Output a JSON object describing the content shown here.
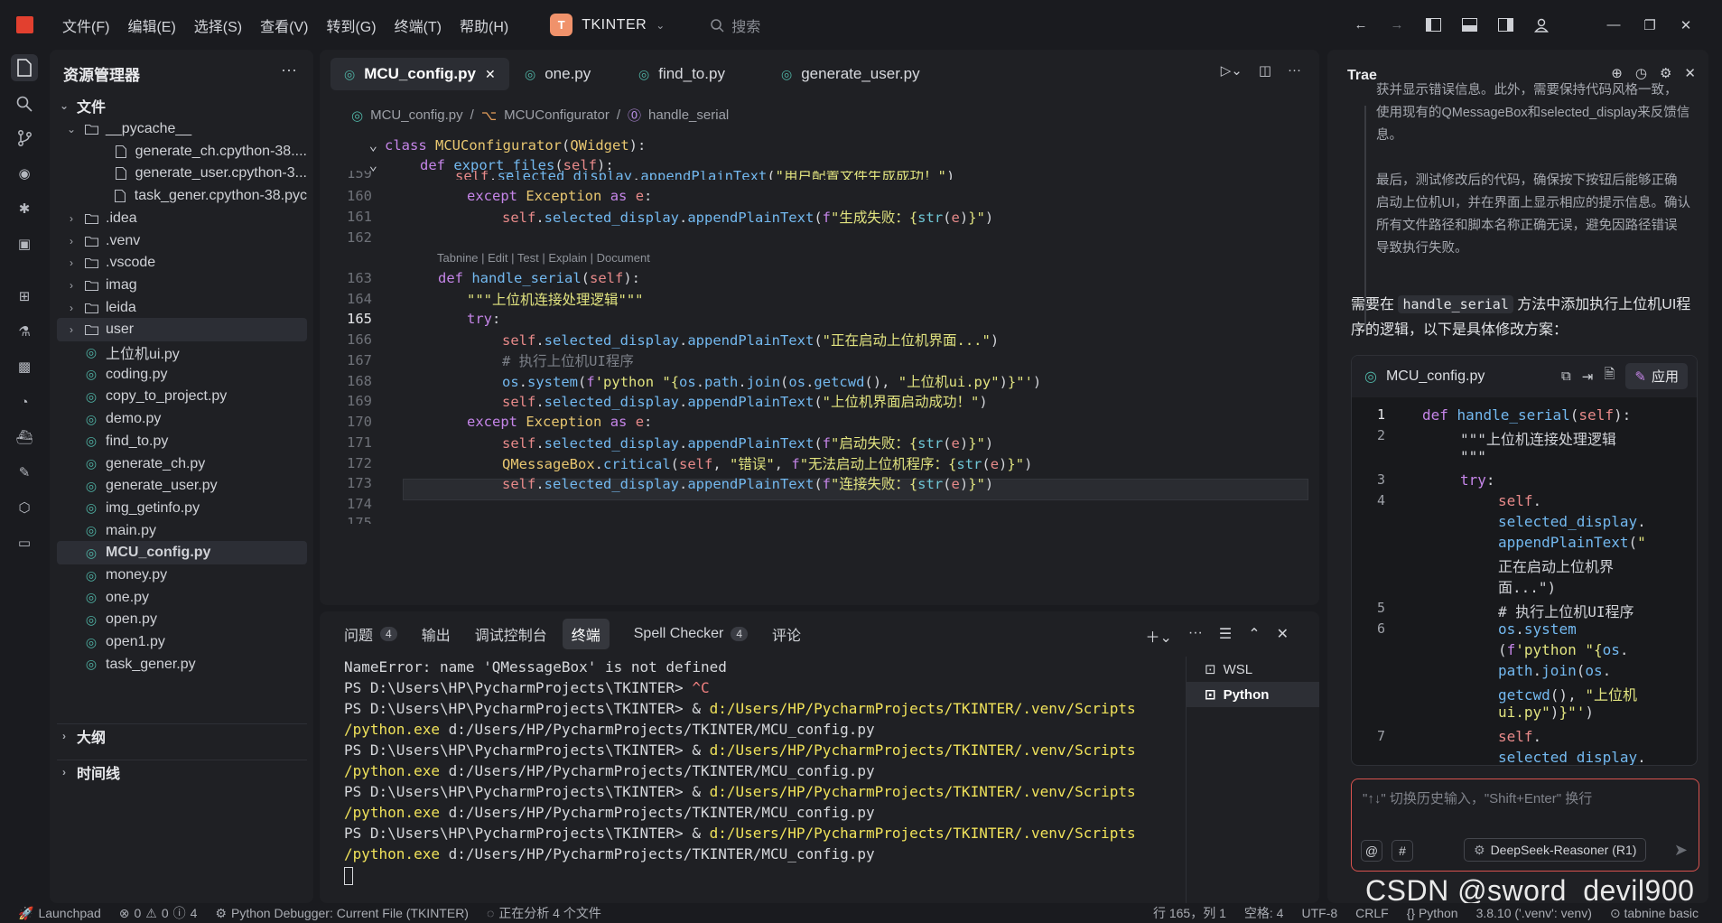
{
  "titlebar": {
    "menu": [
      "文件(F)",
      "编辑(E)",
      "选择(S)",
      "查看(V)",
      "转到(G)",
      "终端(T)",
      "帮助(H)"
    ],
    "project_badge": "T",
    "project_name": "TKINTER",
    "search_placeholder": "搜索"
  },
  "explorer": {
    "title": "资源管理器",
    "section": "文件",
    "items": [
      {
        "label": "__pycache__",
        "type": "folder-open",
        "indent": 1
      },
      {
        "label": "generate_ch.cpython-38....",
        "type": "file",
        "indent": 2
      },
      {
        "label": "generate_user.cpython-3...",
        "type": "file",
        "indent": 2
      },
      {
        "label": "task_gener.cpython-38.pyc",
        "type": "file",
        "indent": 2
      },
      {
        "label": ".idea",
        "type": "folder",
        "indent": 1
      },
      {
        "label": ".venv",
        "type": "folder",
        "indent": 1
      },
      {
        "label": ".vscode",
        "type": "folder",
        "indent": 1
      },
      {
        "label": "imag",
        "type": "folder",
        "indent": 1
      },
      {
        "label": "leida",
        "type": "folder",
        "indent": 1
      },
      {
        "label": "user",
        "type": "folder",
        "indent": 1
      },
      {
        "label": "上位机ui.py",
        "type": "py",
        "indent": 1
      },
      {
        "label": "coding.py",
        "type": "py",
        "indent": 1
      },
      {
        "label": "copy_to_project.py",
        "type": "py",
        "indent": 1
      },
      {
        "label": "demo.py",
        "type": "py",
        "indent": 1
      },
      {
        "label": "find_to.py",
        "type": "py",
        "indent": 1
      },
      {
        "label": "generate_ch.py",
        "type": "py",
        "indent": 1
      },
      {
        "label": "generate_user.py",
        "type": "py",
        "indent": 1
      },
      {
        "label": "img_getinfo.py",
        "type": "py",
        "indent": 1
      },
      {
        "label": "main.py",
        "type": "py",
        "indent": 1
      },
      {
        "label": "MCU_config.py",
        "type": "py",
        "indent": 1
      },
      {
        "label": "money.py",
        "type": "py",
        "indent": 1
      },
      {
        "label": "one.py",
        "type": "py",
        "indent": 1
      },
      {
        "label": "open.py",
        "type": "py",
        "indent": 1
      },
      {
        "label": "open1.py",
        "type": "py",
        "indent": 1
      },
      {
        "label": "task_gener.py",
        "type": "py",
        "indent": 1
      }
    ],
    "outline": "大纲",
    "timeline": "时间线"
  },
  "editor": {
    "tabs": [
      "MCU_config.py",
      "one.py",
      "find_to.py",
      "generate_user.py"
    ],
    "breadcrumb": [
      "MCU_config.py",
      "MCUConfigurator",
      "handle_serial"
    ],
    "sticky": [
      "class MCUConfigurator(QWidget):",
      "def export_files(self):"
    ],
    "tabnine_hint": "Tabnine | Edit | Test | Explain | Document",
    "line_numbers": [
      "159",
      "160",
      "161",
      "162",
      "163",
      "164",
      "165",
      "166",
      "167",
      "168",
      "169",
      "170",
      "171",
      "172",
      "173",
      "174",
      "175"
    ]
  },
  "panel": {
    "tabs": [
      {
        "label": "问题",
        "count": "4"
      },
      {
        "label": "输出",
        "count": ""
      },
      {
        "label": "调试控制台",
        "count": ""
      },
      {
        "label": "终端",
        "count": ""
      },
      {
        "label": "Spell Checker",
        "count": "4"
      },
      {
        "label": "评论",
        "count": ""
      }
    ],
    "terminal_lines": [
      "NameError: name 'QMessageBox' is not defined",
      "PS D:\\Users\\HP\\PycharmProjects\\TKINTER> ^C",
      "PS D:\\Users\\HP\\PycharmProjects\\TKINTER> & d:/Users/HP/PycharmProjects/TKINTER/.venv/Scripts",
      "/python.exe d:/Users/HP/PycharmProjects/TKINTER/MCU_config.py"
    ],
    "prompt": "PS D:\\Users\\HP\\PycharmProjects\\TKINTER> & ",
    "cmd_path": "d:/Users/HP/PycharmProjects/TKINTER/.venv/Scripts",
    "cmd_exe": "/python.exe",
    "cmd_arg": " d:/Users/HP/PycharmProjects/TKINTER/MCU_config.py",
    "terminals": [
      "WSL",
      "Python"
    ]
  },
  "ai": {
    "title": "Trae",
    "quote_lines": [
      "获并显示错误信息。此外，需要保持代码风格一致，",
      "使用现有的QMessageBox和selected_display来反馈信",
      "息。",
      "",
      "最后，测试修改后的代码，确保按下按钮后能够正确",
      "启动上位机UI，并在界面上显示相应的提示信息。确认",
      "所有文件路径和脚本名称正确无误，避免因路径错误",
      "导致执行失败。"
    ],
    "msg_pre": "需要在 ",
    "msg_code": "handle_serial",
    "msg_post": " 方法中添加执行上位机UI程序的逻辑，以下是具体修改方案：",
    "card_file": "MCU_config.py",
    "apply_label": "应用",
    "input_placeholder": "\"↑↓\" 切换历史输入，\"Shift+Enter\" 换行",
    "model": "DeepSeek-Reasoner (R1)"
  },
  "status": {
    "launchpad": "Launchpad",
    "errors": "0",
    "warnings": "0",
    "infos": "4",
    "debugger": "Python Debugger: Current File (TKINTER)",
    "analyzing": "正在分析 4 个文件",
    "position": "行 165，列 1",
    "spaces": "空格: 4",
    "encoding": "UTF-8",
    "eol": "CRLF",
    "language": "Python",
    "interpreter": "3.8.10 ('.venv': venv)",
    "tabnine": "tabnine basic"
  },
  "watermark": "CSDN @sword_devil900",
  "colors": {
    "accent_red": "#e2402f",
    "project_badge": "#f0926b",
    "terminal_path": "#f0e25a",
    "py_icon": "#4fb3a5"
  }
}
